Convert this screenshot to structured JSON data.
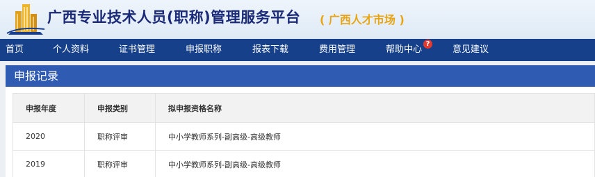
{
  "header": {
    "title": "广西专业技术人员(职称)管理服务平台",
    "subtitle": "( 广西人才市场 )"
  },
  "nav": {
    "items": [
      {
        "label": "首页"
      },
      {
        "label": "个人资料"
      },
      {
        "label": "证书管理"
      },
      {
        "label": "申报职称"
      },
      {
        "label": "报表下载"
      },
      {
        "label": "费用管理"
      },
      {
        "label": "帮助中心"
      },
      {
        "label": "意见建议"
      }
    ],
    "help_badge": "?"
  },
  "panel": {
    "title": "申报记录",
    "table": {
      "headers": [
        "申报年度",
        "申报类别",
        "拟申报资格名称"
      ],
      "rows": [
        [
          "2020",
          "职称评审",
          "中小学教师系列-副高级-高级教师"
        ],
        [
          "2019",
          "职称评审",
          "中小学教师系列-副高级-高级教师"
        ]
      ]
    }
  },
  "colors": {
    "nav_bg": "#16408a",
    "panel_header_bg": "#2f5bb2",
    "title": "#1a2a78",
    "subtitle": "#e8a513",
    "badge": "#e23a2f"
  }
}
